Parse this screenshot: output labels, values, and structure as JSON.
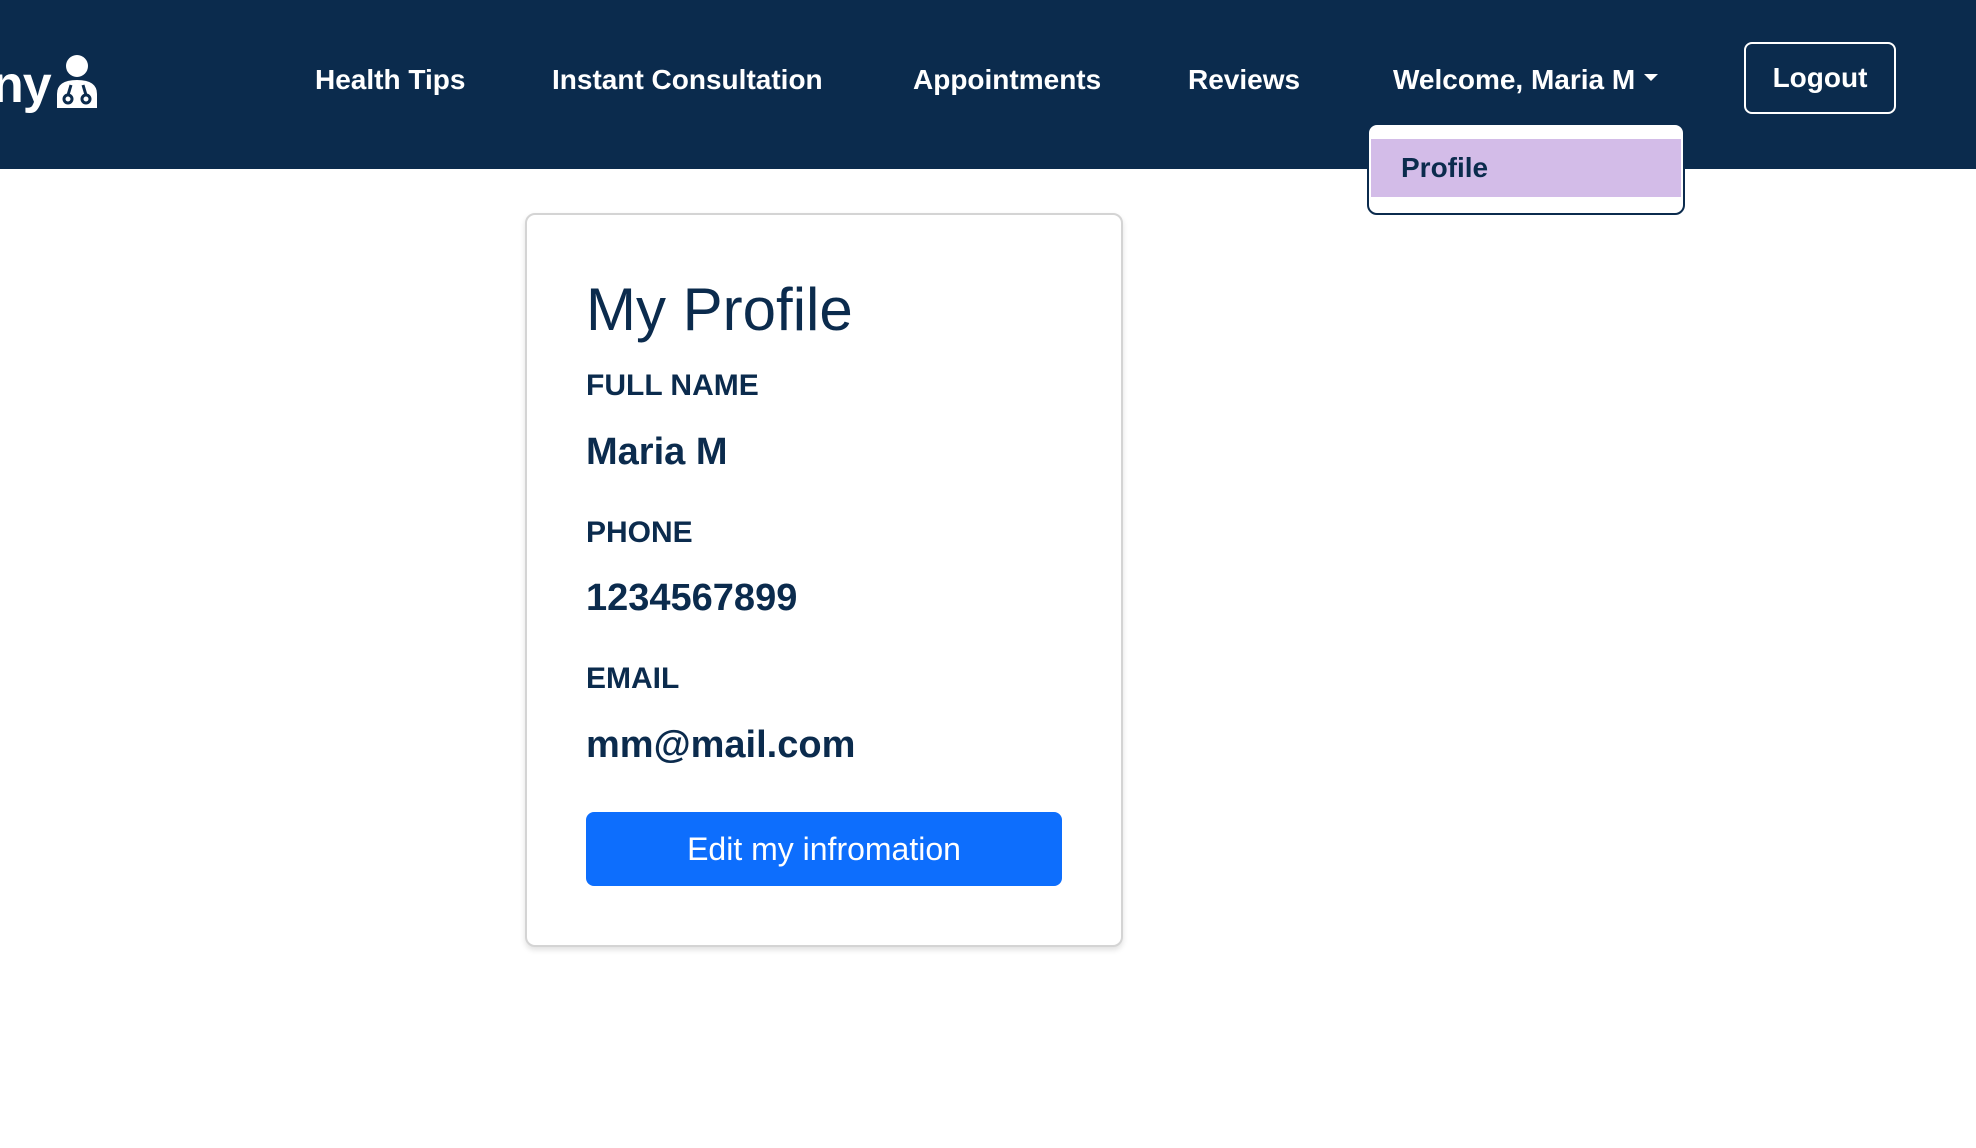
{
  "brand": {
    "text": "ny"
  },
  "nav": {
    "items": [
      {
        "label": "Health Tips"
      },
      {
        "label": "Instant Consultation"
      },
      {
        "label": "Appointments"
      },
      {
        "label": "Reviews"
      }
    ],
    "welcome_label": "Welcome, Maria M",
    "logout_label": "Logout"
  },
  "dropdown": {
    "items": [
      {
        "label": "Profile"
      }
    ]
  },
  "profile": {
    "title": "My Profile",
    "fields": [
      {
        "label": "FULL NAME",
        "value": "Maria M"
      },
      {
        "label": "PHONE",
        "value": "1234567899"
      },
      {
        "label": "EMAIL",
        "value": "mm@mail.com"
      }
    ],
    "edit_label": "Edit my infromation"
  },
  "colors": {
    "navbar": "#0b2b4d",
    "dropdown_highlight": "#d3bce8",
    "primary_button": "#0d6efd"
  }
}
